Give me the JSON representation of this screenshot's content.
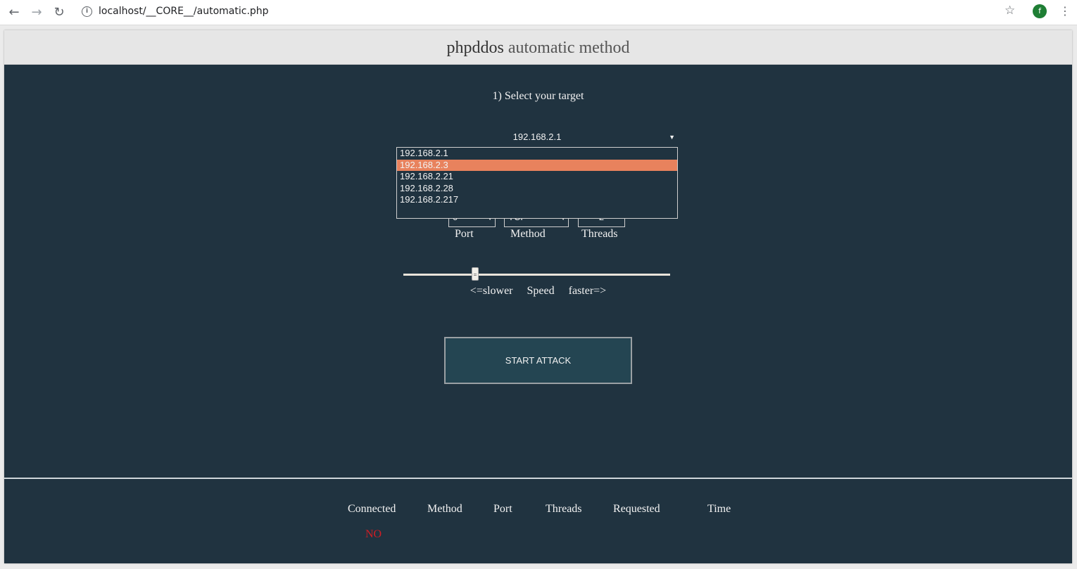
{
  "browser": {
    "url": "localhost/__CORE__/automatic.php",
    "avatar_initial": "f",
    "icons": [
      "back-icon",
      "forward-icon",
      "reload-icon",
      "info-icon",
      "star-icon",
      "menu-icon"
    ]
  },
  "header": {
    "brand": "phpddos",
    "subtitle": "automatic method"
  },
  "step_label": "1) Select your target",
  "target": {
    "selected": "192.168.2.1",
    "options": [
      "192.168.2.1",
      "192.168.2.3",
      "192.168.2.21",
      "192.168.2.28",
      "192.168.2.217"
    ],
    "highlighted_index": 1,
    "highlight_color": "#e8825d"
  },
  "controls": {
    "port_value": "0",
    "method_value": "TCP",
    "threads_value": "2",
    "port_label": "Port",
    "method_label": "Method",
    "threads_label": "Threads"
  },
  "speed": {
    "slower_label": "<=slower",
    "label": "Speed",
    "faster_label": "faster=>",
    "level_fraction": 0.27
  },
  "start_button_label": "START ATTACK",
  "stats": {
    "headers": [
      "Connected",
      "Method",
      "Port",
      "Threads",
      "Requested",
      "Time"
    ],
    "connected_value": "NO",
    "connected_color": "#d11d24"
  },
  "colors": {
    "page_background": "#203340",
    "header_background": "#e6e6e6"
  }
}
